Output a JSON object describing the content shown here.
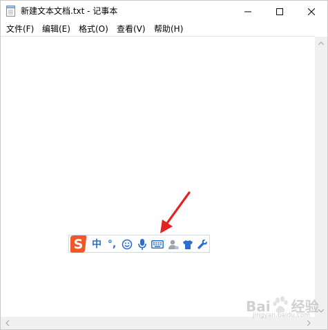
{
  "window": {
    "title": "新建文本文档.txt - 记事本"
  },
  "menu": {
    "file": "文件(F)",
    "edit": "编辑(E)",
    "format": "格式(O)",
    "view": "查看(V)",
    "help": "帮助(H)"
  },
  "ime": {
    "mode_label": "中",
    "punct_label": "°,",
    "icons": [
      "sogou-logo-icon",
      "emoji-icon",
      "microphone-icon",
      "keyboard-icon",
      "user-icon",
      "skin-icon",
      "wrench-icon"
    ]
  },
  "watermark": {
    "brand": "Bai",
    "suffix": "经验",
    "url": "jingyan.baidu.com"
  },
  "colors": {
    "ime_blue": "#2a6fd0",
    "sogou_orange": "#f0582a",
    "arrow_red": "#e32222"
  }
}
